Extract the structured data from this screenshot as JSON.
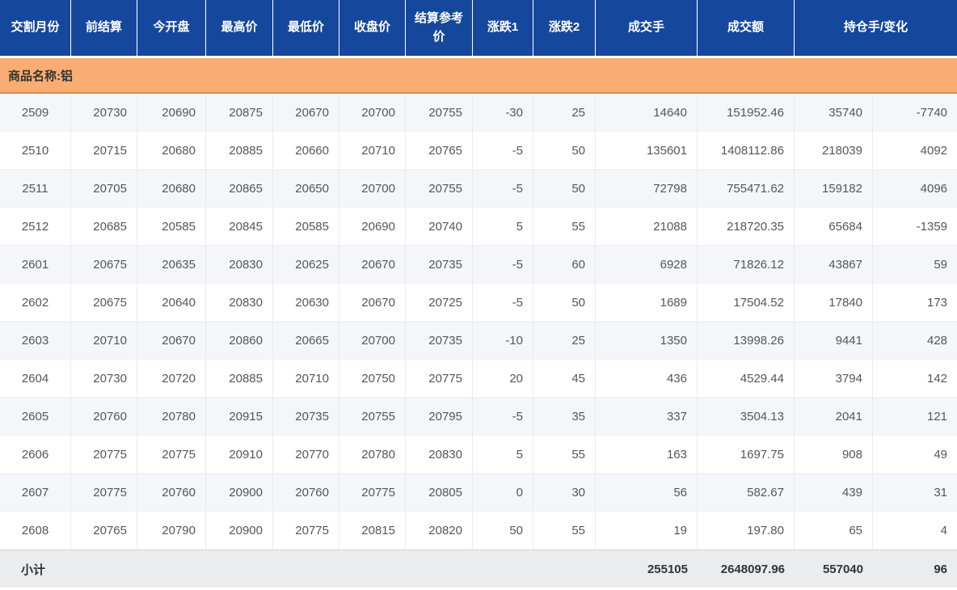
{
  "colors": {
    "header_bg": "#15489D",
    "header_text": "#FFFFFF",
    "group_bg": "#F9AD72",
    "group_border": "#D98A52",
    "stripe_bg": "#F4F6FA",
    "row_bg": "#FFFFFF",
    "body_text": "#54565B",
    "footer_bg": "#EBECEE",
    "footer_text": "#333333",
    "grid_v": "#E9EBF0",
    "grid_h": "#F0F1F5"
  },
  "table": {
    "columns": [
      {
        "key": "month",
        "label": "交割月份"
      },
      {
        "key": "prev_settle",
        "label": "前结算"
      },
      {
        "key": "open",
        "label": "今开盘"
      },
      {
        "key": "high",
        "label": "最高价"
      },
      {
        "key": "low",
        "label": "最低价"
      },
      {
        "key": "close",
        "label": "收盘价"
      },
      {
        "key": "settle_ref",
        "label": "结算参考价"
      },
      {
        "key": "change1",
        "label": "涨跌1"
      },
      {
        "key": "change2",
        "label": "涨跌2"
      },
      {
        "key": "volume",
        "label": "成交手"
      },
      {
        "key": "turnover",
        "label": "成交额"
      },
      {
        "key": "oi_and_change",
        "label": "持仓手/变化"
      }
    ],
    "column_keys": [
      "month",
      "prev_settle",
      "open",
      "high",
      "low",
      "close",
      "settle_ref",
      "change1",
      "change2",
      "volume",
      "turnover",
      "open_interest",
      "oi_change"
    ],
    "group_label": "商品名称:铝",
    "rows": [
      [
        "2509",
        "20730",
        "20690",
        "20875",
        "20670",
        "20700",
        "20755",
        "-30",
        "25",
        "14640",
        "151952.46",
        "35740",
        "-7740"
      ],
      [
        "2510",
        "20715",
        "20680",
        "20885",
        "20660",
        "20710",
        "20765",
        "-5",
        "50",
        "135601",
        "1408112.86",
        "218039",
        "4092"
      ],
      [
        "2511",
        "20705",
        "20680",
        "20865",
        "20650",
        "20700",
        "20755",
        "-5",
        "50",
        "72798",
        "755471.62",
        "159182",
        "4096"
      ],
      [
        "2512",
        "20685",
        "20585",
        "20845",
        "20585",
        "20690",
        "20740",
        "5",
        "55",
        "21088",
        "218720.35",
        "65684",
        "-1359"
      ],
      [
        "2601",
        "20675",
        "20635",
        "20830",
        "20625",
        "20670",
        "20735",
        "-5",
        "60",
        "6928",
        "71826.12",
        "43867",
        "59"
      ],
      [
        "2602",
        "20675",
        "20640",
        "20830",
        "20630",
        "20670",
        "20725",
        "-5",
        "50",
        "1689",
        "17504.52",
        "17840",
        "173"
      ],
      [
        "2603",
        "20710",
        "20670",
        "20860",
        "20665",
        "20700",
        "20735",
        "-10",
        "25",
        "1350",
        "13998.26",
        "9441",
        "428"
      ],
      [
        "2604",
        "20730",
        "20720",
        "20885",
        "20710",
        "20750",
        "20775",
        "20",
        "45",
        "436",
        "4529.44",
        "3794",
        "142"
      ],
      [
        "2605",
        "20760",
        "20780",
        "20915",
        "20735",
        "20755",
        "20795",
        "-5",
        "35",
        "337",
        "3504.13",
        "2041",
        "121"
      ],
      [
        "2606",
        "20775",
        "20775",
        "20910",
        "20770",
        "20780",
        "20830",
        "5",
        "55",
        "163",
        "1697.75",
        "908",
        "49"
      ],
      [
        "2607",
        "20775",
        "20760",
        "20900",
        "20760",
        "20775",
        "20805",
        "0",
        "30",
        "56",
        "582.67",
        "439",
        "31"
      ],
      [
        "2608",
        "20765",
        "20790",
        "20900",
        "20775",
        "20815",
        "20820",
        "50",
        "55",
        "19",
        "197.80",
        "65",
        "4"
      ]
    ],
    "footer": {
      "label": "小计",
      "volume": "255105",
      "turnover": "2648097.96",
      "open_interest": "557040",
      "oi_change": "96"
    }
  }
}
